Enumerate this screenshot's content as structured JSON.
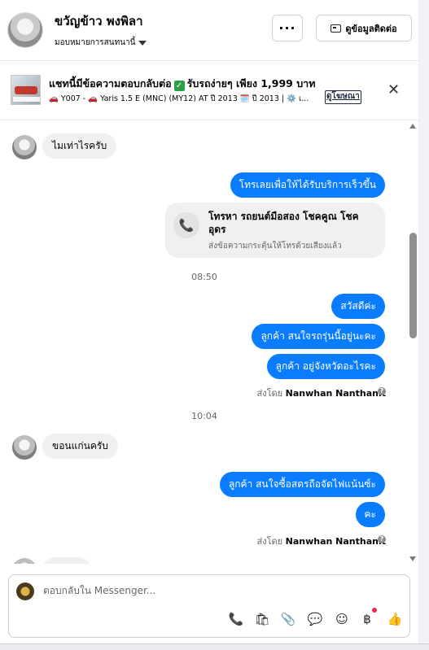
{
  "header": {
    "name": "ขวัญข้าว พงพิลา",
    "assign_label": "มอบหมายการสนทนานี้",
    "more_label": "···",
    "contact_label": "ดูข้อมูลติดต่อ"
  },
  "banner": {
    "title_part1": "แชทนี้มีข้อความตอบกลับต่อ",
    "title_part2": "รับรถง่ายๆ เพียง 1,999 บาท",
    "desc": "🚗 Y007 - 🚗 Yaris 1.5 E (MNC) (MY12) AT ปี 2013 🗓️ ปี 2013 | ⚙️ เ...",
    "ad_link": "ดูโฆษณา",
    "close_label": "✕"
  },
  "messages": {
    "m1": "ไมเท่าไรครับ",
    "m2": "โทรเลยเพื่อให้ได้รับบริการเร็วขึ้น",
    "call_title": "โทรหา รถยนต์มือสอง โชคคูณ โชค อุดร",
    "call_sub": "ส่งข้อความกระตุ้นให้โทรด้วยเสียงแล้ว",
    "time1": "08:50",
    "m3": "สวัสดีค่ะ",
    "m4": "ลูกค้า สนใจรถรุ่นนี้อยู่นะคะ",
    "m5": "ลูกค้า อยู่จังหวัดอะไรคะ",
    "sent_by_prefix": "ส่งโดย",
    "sent_by_name": "Nanwhan Nanthanit",
    "time2": "10:04",
    "m6": "ขอนแก่นครับ",
    "m7": "ลูกค้า สนใจซื้อสดรถือจัดไฟแน้นซ์ะ",
    "m8": "คะ",
    "sent_by_prefix2": "ส่งโดย",
    "sent_by_name2": "Nanwhan Nanthanit"
  },
  "composer": {
    "placeholder": "ตอบกลับใน Messenger...",
    "tools": [
      "phone-plus-icon",
      "shopping-bag-icon",
      "paperclip-icon",
      "chat-bubble-icon",
      "emoji-icon",
      "baht-icon",
      "thumbs-up-icon"
    ]
  }
}
